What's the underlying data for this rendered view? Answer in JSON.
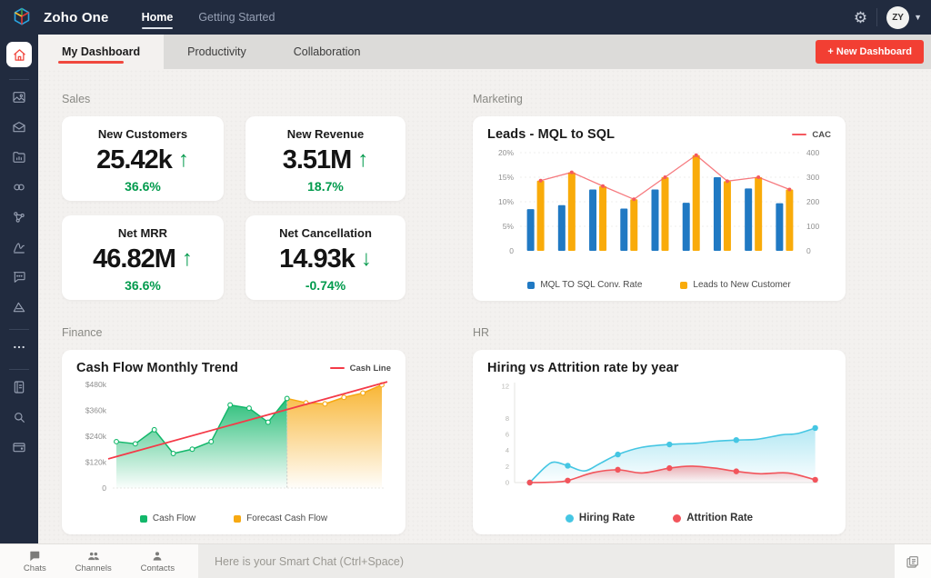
{
  "topbar": {
    "brand": "Zoho One",
    "nav": [
      {
        "label": "Home",
        "active": true
      },
      {
        "label": "Getting Started",
        "active": false
      }
    ],
    "avatar": "ZY"
  },
  "tabbar": {
    "tabs": [
      {
        "label": "My Dashboard",
        "active": true
      },
      {
        "label": "Productivity",
        "active": false
      },
      {
        "label": "Collaboration",
        "active": false
      }
    ],
    "new_dashboard_label": "+ New Dashboard"
  },
  "sidebar": {
    "icons": [
      "home",
      "gallery",
      "mail",
      "reports",
      "link",
      "network",
      "signature",
      "chat",
      "analytics",
      "more",
      "notebook",
      "search",
      "wallet"
    ]
  },
  "sections": {
    "sales": "Sales",
    "marketing": "Marketing",
    "finance": "Finance",
    "hr": "HR"
  },
  "kpis": [
    {
      "title": "New Customers",
      "value": "25.42k",
      "arrow": "↑",
      "change": "36.6%"
    },
    {
      "title": "New Revenue",
      "value": "3.51M",
      "arrow": "↑",
      "change": "18.7%"
    },
    {
      "title": "Net MRR",
      "value": "46.82M",
      "arrow": "↑",
      "change": "36.6%"
    },
    {
      "title": "Net Cancellation",
      "value": "14.93k",
      "arrow": "↓",
      "change": "-0.74%"
    }
  ],
  "chart_data": [
    {
      "id": "marketing",
      "type": "bar",
      "title": "Leads - MQL to SQL",
      "top_legend": {
        "label": "CAC",
        "color": "#f4595f"
      },
      "left_axis": {
        "max": 20,
        "ticks": [
          "0",
          "5%",
          "10%",
          "15%",
          "20%"
        ]
      },
      "right_axis": {
        "max": 400,
        "ticks": [
          "0",
          "100",
          "200",
          "300",
          "400"
        ]
      },
      "legend_position": "bottom",
      "series": [
        {
          "name": "MQL TO SQL Conv. Rate",
          "type": "bar",
          "axis": "left",
          "color": "#2079c3",
          "values": [
            8.5,
            9.3,
            12.5,
            8.6,
            12.5,
            9.8,
            15,
            12.7,
            9.7
          ]
        },
        {
          "name": "Leads to New Customer",
          "type": "bar",
          "axis": "left",
          "color": "#f9ab0a",
          "values": [
            14.3,
            16,
            13.2,
            10.5,
            15,
            19.5,
            14.2,
            15,
            12.5
          ]
        },
        {
          "name": "CAC",
          "type": "line",
          "axis": "right",
          "color": "#f4595f",
          "values": [
            286,
            320,
            264,
            210,
            300,
            390,
            284,
            300,
            250
          ]
        }
      ]
    },
    {
      "id": "finance",
      "type": "area",
      "title": "Cash Flow Monthly Trend",
      "top_legend": {
        "label": "Cash Line",
        "color": "#f43a48"
      },
      "y_axis": {
        "max": 480,
        "ticks": [
          "0",
          "$120k",
          "$240k",
          "$360k",
          "$480k"
        ]
      },
      "legend_position": "bottom",
      "series": [
        {
          "name": "Cash Flow",
          "color": "#12b76a",
          "values": [
            215,
            205,
            270,
            160,
            180,
            215,
            385,
            370,
            305,
            415
          ]
        },
        {
          "name": "Forecast Cash Flow",
          "color": "#f7a912",
          "values": [
            415,
            395,
            390,
            420,
            440,
            478
          ]
        }
      ],
      "trend": {
        "name": "Cash Line",
        "color": "#f43a48",
        "start": 135,
        "end": 492
      }
    },
    {
      "id": "hr",
      "type": "line",
      "title": "Hiring vs Attrition rate by year",
      "y_axis": {
        "max": 12,
        "ticks": [
          0,
          2,
          4,
          6,
          8,
          12
        ]
      },
      "legend_position": "bottom",
      "series": [
        {
          "name": "Hiring Rate",
          "color": "#45c6e3",
          "x": [
            0.05,
            0.175,
            0.34,
            0.51,
            0.73,
            0.99
          ],
          "values": [
            0,
            2.1,
            3.5,
            4.75,
            5.3,
            6.8
          ],
          "shape": [
            [
              0.05,
              0
            ],
            [
              0.1,
              1.9
            ],
            [
              0.13,
              2.55
            ],
            [
              0.175,
              2.1
            ],
            [
              0.23,
              1.45
            ],
            [
              0.28,
              2.35
            ],
            [
              0.34,
              3.5
            ],
            [
              0.42,
              4.4
            ],
            [
              0.51,
              4.75
            ],
            [
              0.6,
              4.9
            ],
            [
              0.66,
              5.15
            ],
            [
              0.73,
              5.3
            ],
            [
              0.8,
              5.4
            ],
            [
              0.88,
              5.95
            ],
            [
              0.93,
              6.1
            ],
            [
              0.99,
              6.8
            ]
          ]
        },
        {
          "name": "Attrition Rate",
          "color": "#f2545b",
          "x": [
            0.05,
            0.175,
            0.34,
            0.51,
            0.73,
            0.99
          ],
          "values": [
            0,
            0.25,
            1.6,
            1.8,
            1.4,
            0.35
          ],
          "shape": [
            [
              0.05,
              0
            ],
            [
              0.12,
              0.05
            ],
            [
              0.175,
              0.25
            ],
            [
              0.26,
              1.25
            ],
            [
              0.34,
              1.6
            ],
            [
              0.42,
              1.2
            ],
            [
              0.51,
              1.8
            ],
            [
              0.58,
              2.05
            ],
            [
              0.66,
              1.8
            ],
            [
              0.73,
              1.4
            ],
            [
              0.81,
              1.1
            ],
            [
              0.9,
              1.2
            ],
            [
              0.99,
              0.35
            ]
          ]
        }
      ]
    }
  ],
  "bottombar": {
    "items": [
      {
        "label": "Chats"
      },
      {
        "label": "Channels"
      },
      {
        "label": "Contacts"
      }
    ],
    "chat_placeholder": "Here is your Smart Chat (Ctrl+Space)"
  },
  "colors": {
    "navy": "#212b3f",
    "accent_red": "#f23f33",
    "green": "#009a4c",
    "bar_blue": "#2079c3",
    "bar_orange": "#f9ab0a",
    "line_red": "#f4595f",
    "cash_green": "#12b76a",
    "forecast_orange": "#f7a912",
    "hiring_cyan": "#45c6e3",
    "attrition_red": "#f2545b"
  }
}
